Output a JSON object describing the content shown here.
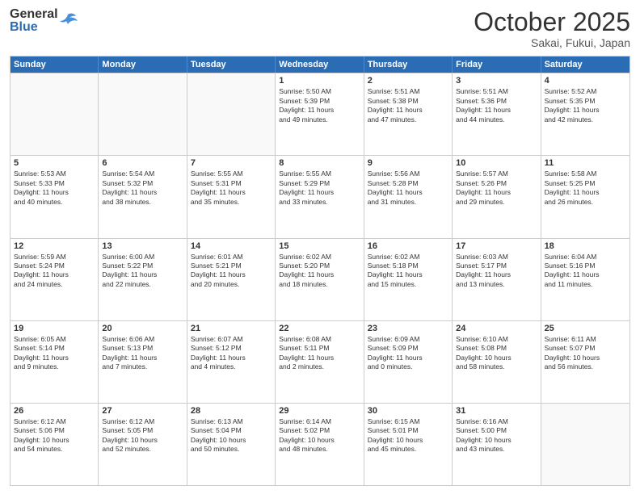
{
  "header": {
    "logo": {
      "general": "General",
      "blue": "Blue"
    },
    "month": "October 2025",
    "location": "Sakai, Fukui, Japan"
  },
  "dayHeaders": [
    "Sunday",
    "Monday",
    "Tuesday",
    "Wednesday",
    "Thursday",
    "Friday",
    "Saturday"
  ],
  "weeks": [
    [
      {
        "date": "",
        "info": ""
      },
      {
        "date": "",
        "info": ""
      },
      {
        "date": "",
        "info": ""
      },
      {
        "date": "1",
        "info": "Sunrise: 5:50 AM\nSunset: 5:39 PM\nDaylight: 11 hours\nand 49 minutes."
      },
      {
        "date": "2",
        "info": "Sunrise: 5:51 AM\nSunset: 5:38 PM\nDaylight: 11 hours\nand 47 minutes."
      },
      {
        "date": "3",
        "info": "Sunrise: 5:51 AM\nSunset: 5:36 PM\nDaylight: 11 hours\nand 44 minutes."
      },
      {
        "date": "4",
        "info": "Sunrise: 5:52 AM\nSunset: 5:35 PM\nDaylight: 11 hours\nand 42 minutes."
      }
    ],
    [
      {
        "date": "5",
        "info": "Sunrise: 5:53 AM\nSunset: 5:33 PM\nDaylight: 11 hours\nand 40 minutes."
      },
      {
        "date": "6",
        "info": "Sunrise: 5:54 AM\nSunset: 5:32 PM\nDaylight: 11 hours\nand 38 minutes."
      },
      {
        "date": "7",
        "info": "Sunrise: 5:55 AM\nSunset: 5:31 PM\nDaylight: 11 hours\nand 35 minutes."
      },
      {
        "date": "8",
        "info": "Sunrise: 5:55 AM\nSunset: 5:29 PM\nDaylight: 11 hours\nand 33 minutes."
      },
      {
        "date": "9",
        "info": "Sunrise: 5:56 AM\nSunset: 5:28 PM\nDaylight: 11 hours\nand 31 minutes."
      },
      {
        "date": "10",
        "info": "Sunrise: 5:57 AM\nSunset: 5:26 PM\nDaylight: 11 hours\nand 29 minutes."
      },
      {
        "date": "11",
        "info": "Sunrise: 5:58 AM\nSunset: 5:25 PM\nDaylight: 11 hours\nand 26 minutes."
      }
    ],
    [
      {
        "date": "12",
        "info": "Sunrise: 5:59 AM\nSunset: 5:24 PM\nDaylight: 11 hours\nand 24 minutes."
      },
      {
        "date": "13",
        "info": "Sunrise: 6:00 AM\nSunset: 5:22 PM\nDaylight: 11 hours\nand 22 minutes."
      },
      {
        "date": "14",
        "info": "Sunrise: 6:01 AM\nSunset: 5:21 PM\nDaylight: 11 hours\nand 20 minutes."
      },
      {
        "date": "15",
        "info": "Sunrise: 6:02 AM\nSunset: 5:20 PM\nDaylight: 11 hours\nand 18 minutes."
      },
      {
        "date": "16",
        "info": "Sunrise: 6:02 AM\nSunset: 5:18 PM\nDaylight: 11 hours\nand 15 minutes."
      },
      {
        "date": "17",
        "info": "Sunrise: 6:03 AM\nSunset: 5:17 PM\nDaylight: 11 hours\nand 13 minutes."
      },
      {
        "date": "18",
        "info": "Sunrise: 6:04 AM\nSunset: 5:16 PM\nDaylight: 11 hours\nand 11 minutes."
      }
    ],
    [
      {
        "date": "19",
        "info": "Sunrise: 6:05 AM\nSunset: 5:14 PM\nDaylight: 11 hours\nand 9 minutes."
      },
      {
        "date": "20",
        "info": "Sunrise: 6:06 AM\nSunset: 5:13 PM\nDaylight: 11 hours\nand 7 minutes."
      },
      {
        "date": "21",
        "info": "Sunrise: 6:07 AM\nSunset: 5:12 PM\nDaylight: 11 hours\nand 4 minutes."
      },
      {
        "date": "22",
        "info": "Sunrise: 6:08 AM\nSunset: 5:11 PM\nDaylight: 11 hours\nand 2 minutes."
      },
      {
        "date": "23",
        "info": "Sunrise: 6:09 AM\nSunset: 5:09 PM\nDaylight: 11 hours\nand 0 minutes."
      },
      {
        "date": "24",
        "info": "Sunrise: 6:10 AM\nSunset: 5:08 PM\nDaylight: 10 hours\nand 58 minutes."
      },
      {
        "date": "25",
        "info": "Sunrise: 6:11 AM\nSunset: 5:07 PM\nDaylight: 10 hours\nand 56 minutes."
      }
    ],
    [
      {
        "date": "26",
        "info": "Sunrise: 6:12 AM\nSunset: 5:06 PM\nDaylight: 10 hours\nand 54 minutes."
      },
      {
        "date": "27",
        "info": "Sunrise: 6:12 AM\nSunset: 5:05 PM\nDaylight: 10 hours\nand 52 minutes."
      },
      {
        "date": "28",
        "info": "Sunrise: 6:13 AM\nSunset: 5:04 PM\nDaylight: 10 hours\nand 50 minutes."
      },
      {
        "date": "29",
        "info": "Sunrise: 6:14 AM\nSunset: 5:02 PM\nDaylight: 10 hours\nand 48 minutes."
      },
      {
        "date": "30",
        "info": "Sunrise: 6:15 AM\nSunset: 5:01 PM\nDaylight: 10 hours\nand 45 minutes."
      },
      {
        "date": "31",
        "info": "Sunrise: 6:16 AM\nSunset: 5:00 PM\nDaylight: 10 hours\nand 43 minutes."
      },
      {
        "date": "",
        "info": ""
      }
    ]
  ]
}
